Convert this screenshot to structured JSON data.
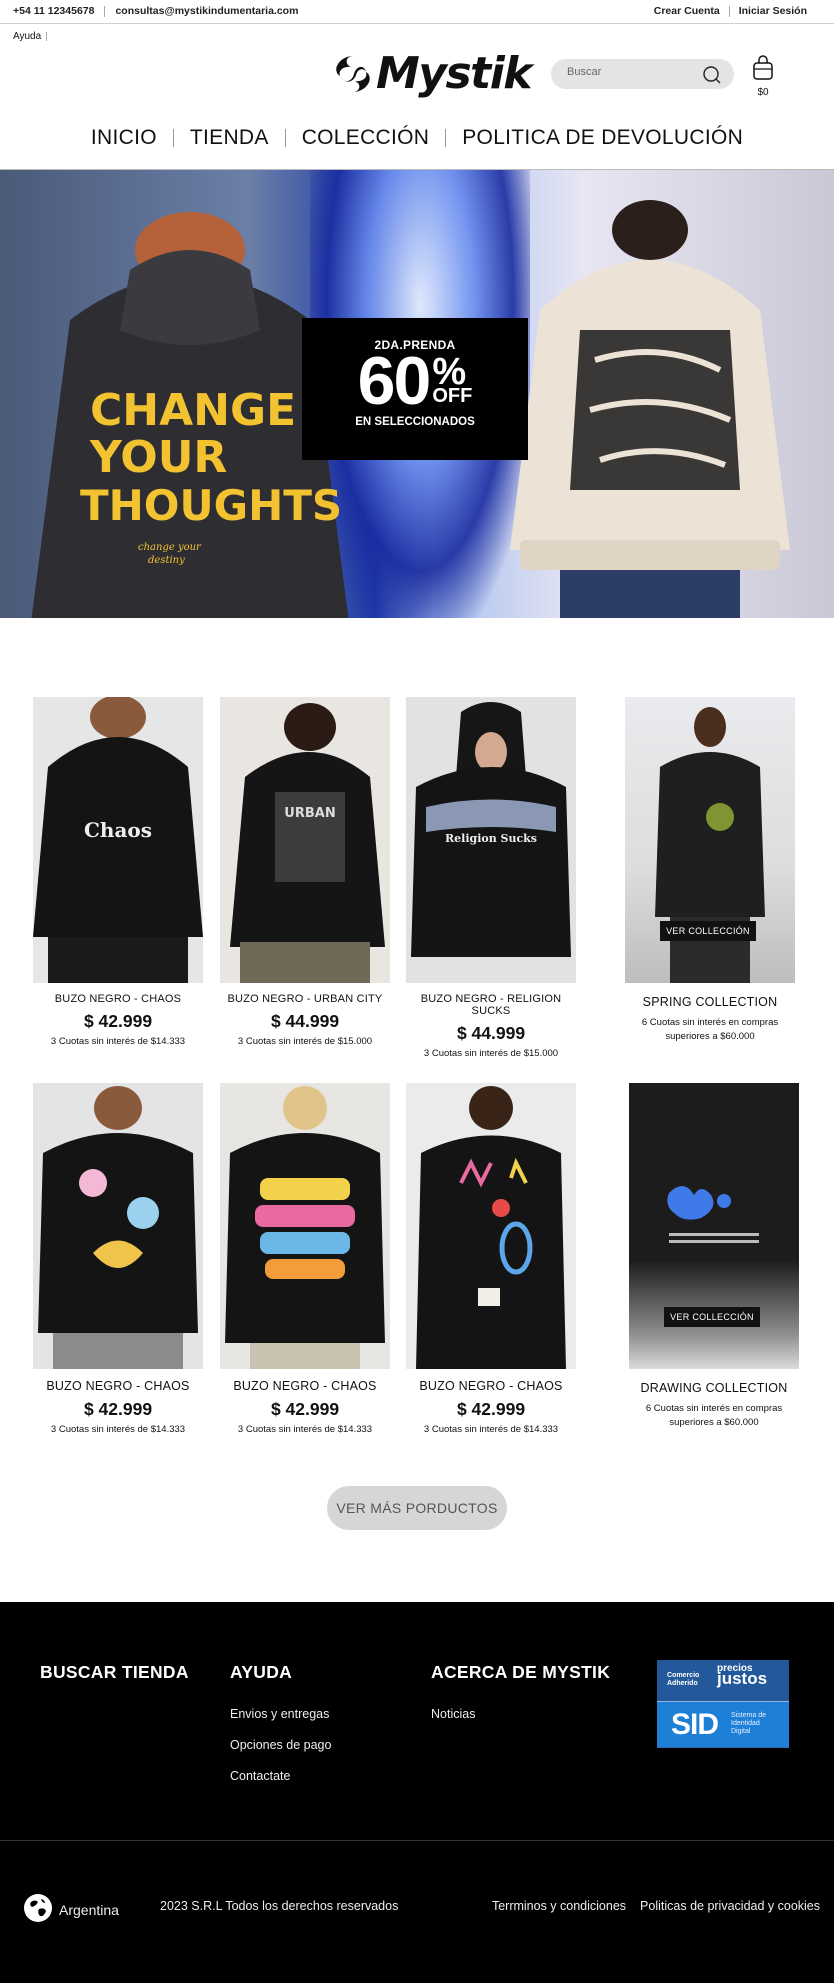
{
  "topbar": {
    "phone": "+54 11 12345678",
    "email": "consultas@mystikindumentaria.com",
    "create_account": "Crear Cuenta",
    "login": "Iniciar Sesión",
    "help": "Ayuda"
  },
  "header": {
    "logo_text": "Mystik",
    "search_placeholder": "Buscar",
    "cart_total": "$0"
  },
  "nav": [
    "INICIO",
    "TIENDA",
    "COLECCIÓN",
    "POLITICA DE DEVOLUCIÓN"
  ],
  "hero": {
    "line1": "2DA.PRENDA",
    "discount": "60",
    "percent": "%",
    "off": "OFF",
    "line3": "EN SELECCIONADOS",
    "hoodie1_text": [
      "CHANGE",
      "YOUR",
      "THOUGHTS"
    ],
    "hoodie1_sub": [
      "change your",
      "destiny"
    ]
  },
  "products_row1": [
    {
      "name": "BUZO NEGRO - CHAOS",
      "price": "$ 42.999",
      "installments": "3 Cuotas sin interés de $14.333",
      "print": "Chaos"
    },
    {
      "name": "BUZO NEGRO - URBAN CITY",
      "price": "$ 44.999",
      "installments": "3 Cuotas sin interés de $15.000",
      "print": "URBAN"
    },
    {
      "name": "BUZO NEGRO - RELIGION SUCKS",
      "price": "$ 44.999",
      "installments": "3 Cuotas sin interés de $15.000",
      "print": "Religion Sucks"
    }
  ],
  "collection1": {
    "name": "SPRING COLLECTION",
    "button": "VER COLLECCIÓN",
    "info": "6 Cuotas sin interés en compras superiores a $60.000"
  },
  "products_row2": [
    {
      "name": "BUZO NEGRO - CHAOS",
      "price": "$ 42.999",
      "installments": "3 Cuotas sin interés de $14.333"
    },
    {
      "name": "BUZO NEGRO - CHAOS",
      "price": "$ 42.999",
      "installments": "3 Cuotas sin interés de $14.333"
    },
    {
      "name": "BUZO NEGRO - CHAOS",
      "price": "$ 42.999",
      "installments": "3 Cuotas sin interés de $14.333"
    }
  ],
  "collection2": {
    "name": "DRAWING COLLECTION",
    "button": "VER COLLECCIÓN",
    "info": "6 Cuotas sin interés en compras superiores a $60.000"
  },
  "more_button": "VER MÁS PORDUCTOS",
  "footer": {
    "col1_title": "BUSCAR TIENDA",
    "col2_title": "AYUDA",
    "col2_items": [
      "Envios y entregas",
      "Opciones de pago",
      "Contactate"
    ],
    "col3_title": "ACERCA DE MYSTIK",
    "col3_items": [
      "Noticias"
    ],
    "badge": {
      "comercio": "Comercio",
      "adherido": "Adherido",
      "precios": "precios",
      "justos": "justos",
      "sid": "SID",
      "sid_text": [
        "Sistema de",
        "Identidad",
        "Digital"
      ]
    },
    "country": "Argentina",
    "copyright": "2023 S.R.L Todos los derechos reservados",
    "terms": "Terrminos y condiciones",
    "privacy": "Politicas de privacidad y cookies"
  },
  "colors": {
    "accent": "#000000",
    "badge_blue": "#2c6fb8",
    "hero_yellow": "#f2c230"
  }
}
